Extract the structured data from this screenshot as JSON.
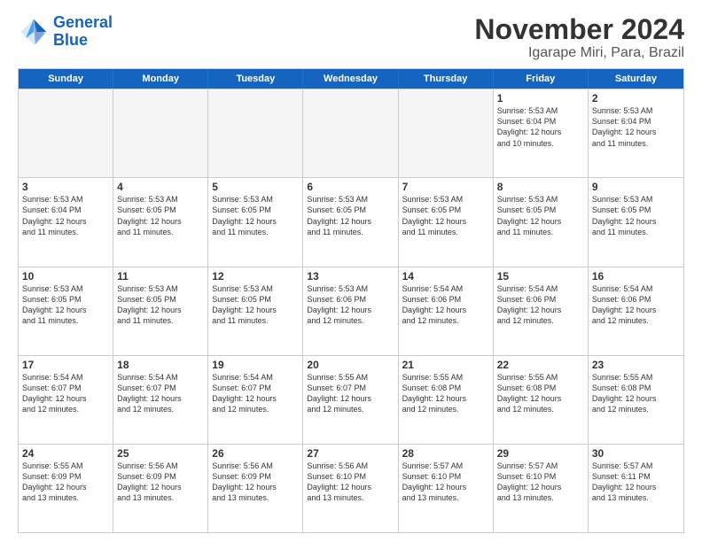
{
  "logo": {
    "line1": "General",
    "line2": "Blue"
  },
  "title": "November 2024",
  "subtitle": "Igarape Miri, Para, Brazil",
  "days": [
    "Sunday",
    "Monday",
    "Tuesday",
    "Wednesday",
    "Thursday",
    "Friday",
    "Saturday"
  ],
  "weeks": [
    [
      {
        "day": "",
        "info": ""
      },
      {
        "day": "",
        "info": ""
      },
      {
        "day": "",
        "info": ""
      },
      {
        "day": "",
        "info": ""
      },
      {
        "day": "",
        "info": ""
      },
      {
        "day": "1",
        "info": "Sunrise: 5:53 AM\nSunset: 6:04 PM\nDaylight: 12 hours\nand 10 minutes."
      },
      {
        "day": "2",
        "info": "Sunrise: 5:53 AM\nSunset: 6:04 PM\nDaylight: 12 hours\nand 11 minutes."
      }
    ],
    [
      {
        "day": "3",
        "info": "Sunrise: 5:53 AM\nSunset: 6:04 PM\nDaylight: 12 hours\nand 11 minutes."
      },
      {
        "day": "4",
        "info": "Sunrise: 5:53 AM\nSunset: 6:05 PM\nDaylight: 12 hours\nand 11 minutes."
      },
      {
        "day": "5",
        "info": "Sunrise: 5:53 AM\nSunset: 6:05 PM\nDaylight: 12 hours\nand 11 minutes."
      },
      {
        "day": "6",
        "info": "Sunrise: 5:53 AM\nSunset: 6:05 PM\nDaylight: 12 hours\nand 11 minutes."
      },
      {
        "day": "7",
        "info": "Sunrise: 5:53 AM\nSunset: 6:05 PM\nDaylight: 12 hours\nand 11 minutes."
      },
      {
        "day": "8",
        "info": "Sunrise: 5:53 AM\nSunset: 6:05 PM\nDaylight: 12 hours\nand 11 minutes."
      },
      {
        "day": "9",
        "info": "Sunrise: 5:53 AM\nSunset: 6:05 PM\nDaylight: 12 hours\nand 11 minutes."
      }
    ],
    [
      {
        "day": "10",
        "info": "Sunrise: 5:53 AM\nSunset: 6:05 PM\nDaylight: 12 hours\nand 11 minutes."
      },
      {
        "day": "11",
        "info": "Sunrise: 5:53 AM\nSunset: 6:05 PM\nDaylight: 12 hours\nand 11 minutes."
      },
      {
        "day": "12",
        "info": "Sunrise: 5:53 AM\nSunset: 6:05 PM\nDaylight: 12 hours\nand 11 minutes."
      },
      {
        "day": "13",
        "info": "Sunrise: 5:53 AM\nSunset: 6:06 PM\nDaylight: 12 hours\nand 12 minutes."
      },
      {
        "day": "14",
        "info": "Sunrise: 5:54 AM\nSunset: 6:06 PM\nDaylight: 12 hours\nand 12 minutes."
      },
      {
        "day": "15",
        "info": "Sunrise: 5:54 AM\nSunset: 6:06 PM\nDaylight: 12 hours\nand 12 minutes."
      },
      {
        "day": "16",
        "info": "Sunrise: 5:54 AM\nSunset: 6:06 PM\nDaylight: 12 hours\nand 12 minutes."
      }
    ],
    [
      {
        "day": "17",
        "info": "Sunrise: 5:54 AM\nSunset: 6:07 PM\nDaylight: 12 hours\nand 12 minutes."
      },
      {
        "day": "18",
        "info": "Sunrise: 5:54 AM\nSunset: 6:07 PM\nDaylight: 12 hours\nand 12 minutes."
      },
      {
        "day": "19",
        "info": "Sunrise: 5:54 AM\nSunset: 6:07 PM\nDaylight: 12 hours\nand 12 minutes."
      },
      {
        "day": "20",
        "info": "Sunrise: 5:55 AM\nSunset: 6:07 PM\nDaylight: 12 hours\nand 12 minutes."
      },
      {
        "day": "21",
        "info": "Sunrise: 5:55 AM\nSunset: 6:08 PM\nDaylight: 12 hours\nand 12 minutes."
      },
      {
        "day": "22",
        "info": "Sunrise: 5:55 AM\nSunset: 6:08 PM\nDaylight: 12 hours\nand 12 minutes."
      },
      {
        "day": "23",
        "info": "Sunrise: 5:55 AM\nSunset: 6:08 PM\nDaylight: 12 hours\nand 12 minutes."
      }
    ],
    [
      {
        "day": "24",
        "info": "Sunrise: 5:55 AM\nSunset: 6:09 PM\nDaylight: 12 hours\nand 13 minutes."
      },
      {
        "day": "25",
        "info": "Sunrise: 5:56 AM\nSunset: 6:09 PM\nDaylight: 12 hours\nand 13 minutes."
      },
      {
        "day": "26",
        "info": "Sunrise: 5:56 AM\nSunset: 6:09 PM\nDaylight: 12 hours\nand 13 minutes."
      },
      {
        "day": "27",
        "info": "Sunrise: 5:56 AM\nSunset: 6:10 PM\nDaylight: 12 hours\nand 13 minutes."
      },
      {
        "day": "28",
        "info": "Sunrise: 5:57 AM\nSunset: 6:10 PM\nDaylight: 12 hours\nand 13 minutes."
      },
      {
        "day": "29",
        "info": "Sunrise: 5:57 AM\nSunset: 6:10 PM\nDaylight: 12 hours\nand 13 minutes."
      },
      {
        "day": "30",
        "info": "Sunrise: 5:57 AM\nSunset: 6:11 PM\nDaylight: 12 hours\nand 13 minutes."
      }
    ]
  ]
}
